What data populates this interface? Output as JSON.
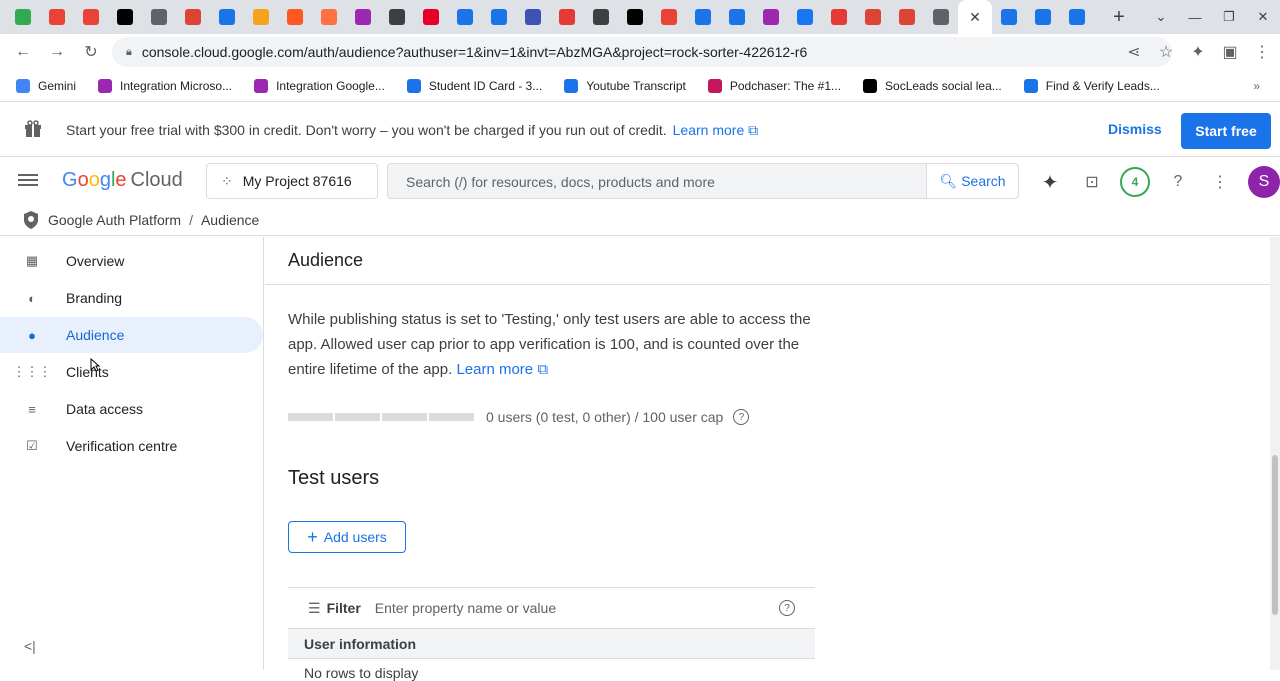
{
  "browser": {
    "tab_favicons": [
      "#34a853",
      "#ea4335",
      "#ea4335",
      "#000000",
      "#5f6368",
      "#db4437",
      "#1a73e8",
      "#f6a21e",
      "#ff5722",
      "#ff7043",
      "#9c27b0",
      "#3c4043",
      "#e60023",
      "#1a73e8",
      "#1a73e8",
      "#3f51b5",
      "#e53935",
      "#3c4043",
      "#000000",
      "#ea4335",
      "#1a73e8",
      "#1a73e8",
      "#9c27b0",
      "#1877f2",
      "#e53935",
      "#db4437",
      "#db4437",
      "#5f6368",
      "#1a73e8",
      "#1a73e8",
      "#1a73e8"
    ],
    "active_tab_close": "✕",
    "new_tab": "+",
    "url": "console.cloud.google.com/auth/audience?authuser=1&inv=1&invt=AbzMGA&project=rock-sorter-422612-r6"
  },
  "bookmarks": [
    {
      "label": "Gemini",
      "color": "#4285f4"
    },
    {
      "label": "Integration Microso...",
      "color": "#9c27b0"
    },
    {
      "label": "Integration Google...",
      "color": "#9c27b0"
    },
    {
      "label": "Student ID Card - 3...",
      "color": "#1a73e8"
    },
    {
      "label": "Youtube Transcript",
      "color": "#1a73e8"
    },
    {
      "label": "Podchaser: The #1...",
      "color": "#c2185b"
    },
    {
      "label": "SocLeads social lea...",
      "color": "#000000"
    },
    {
      "label": "Find & Verify Leads...",
      "color": "#1a73e8"
    }
  ],
  "bookmarks_more": "»",
  "banner": {
    "message": "Start your free trial with $300 in credit. Don't worry – you won't be charged if you run out of credit.",
    "learn_more": "Learn more",
    "dismiss": "Dismiss",
    "start_free": "Start free"
  },
  "header": {
    "logo_google": [
      "G",
      "o",
      "o",
      "g",
      "l",
      "e"
    ],
    "logo_cloud": "Cloud",
    "project": "My Project 87616",
    "search_placeholder": "Search (/) for resources, docs, products and more",
    "search_button": "Search",
    "notifications_count": "4",
    "avatar_letter": "S"
  },
  "breadcrumb": {
    "root": "Google Auth Platform",
    "separator": "/",
    "current": "Audience"
  },
  "sidebar": {
    "items": [
      {
        "label": "Overview",
        "icon": "overview-icon",
        "glyph": "▦"
      },
      {
        "label": "Branding",
        "icon": "palette-icon",
        "glyph": "◐"
      },
      {
        "label": "Audience",
        "icon": "audience-icon",
        "glyph": "●",
        "active": true
      },
      {
        "label": "Clients",
        "icon": "grid-icon",
        "glyph": "⋮⋮⋮"
      },
      {
        "label": "Data access",
        "icon": "data-access-icon",
        "glyph": "≡"
      },
      {
        "label": "Verification centre",
        "icon": "verification-icon",
        "glyph": "☑"
      }
    ],
    "collapse": "<|"
  },
  "main": {
    "title": "Audience",
    "paragraph": "While publishing status is set to 'Testing,' only test users are able to access the app. Allowed user cap prior to app verification is 100, and is counted over the entire lifetime of the app.",
    "learn_more": "Learn more",
    "user_cap_fill": 0,
    "user_cap_text": "0 users (0 test, 0 other) / 100 user cap",
    "test_users_title": "Test users",
    "add_users": "Add users",
    "filter_label": "Filter",
    "filter_placeholder": "Enter property name or value",
    "table_header": "User information",
    "empty_row": "No rows to display"
  }
}
